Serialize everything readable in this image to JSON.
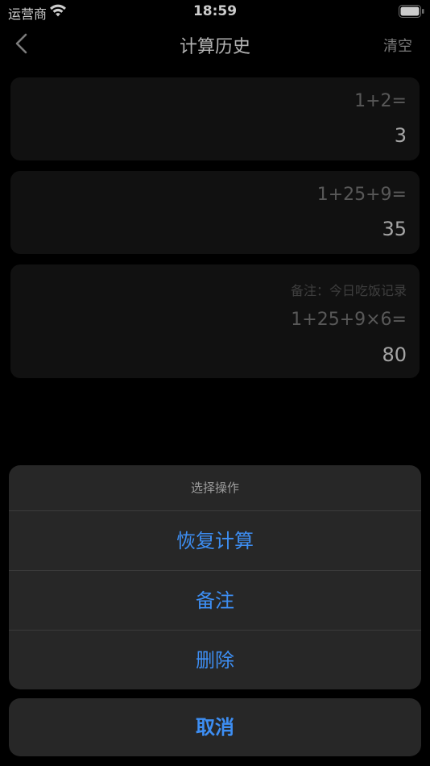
{
  "status_bar": {
    "carrier": "运营商",
    "time": "18:59",
    "wifi_icon": "wifi-icon",
    "battery_icon": "battery-icon"
  },
  "nav": {
    "back_icon": "chevron-left-icon",
    "title": "计算历史",
    "right_action": "清空"
  },
  "history": [
    {
      "note": "",
      "expression": "1+2=",
      "result": "3"
    },
    {
      "note": "",
      "expression": "1+25+9=",
      "result": "35"
    },
    {
      "note": "备注：今日吃饭记录",
      "expression": "1+25+9×6=",
      "result": "80"
    }
  ],
  "action_sheet": {
    "title": "选择操作",
    "options": [
      "恢复计算",
      "备注",
      "删除"
    ],
    "cancel": "取消"
  },
  "colors": {
    "background": "#000000",
    "card": "#161616",
    "sheet": "#272727",
    "accent": "#3d8ef3"
  }
}
